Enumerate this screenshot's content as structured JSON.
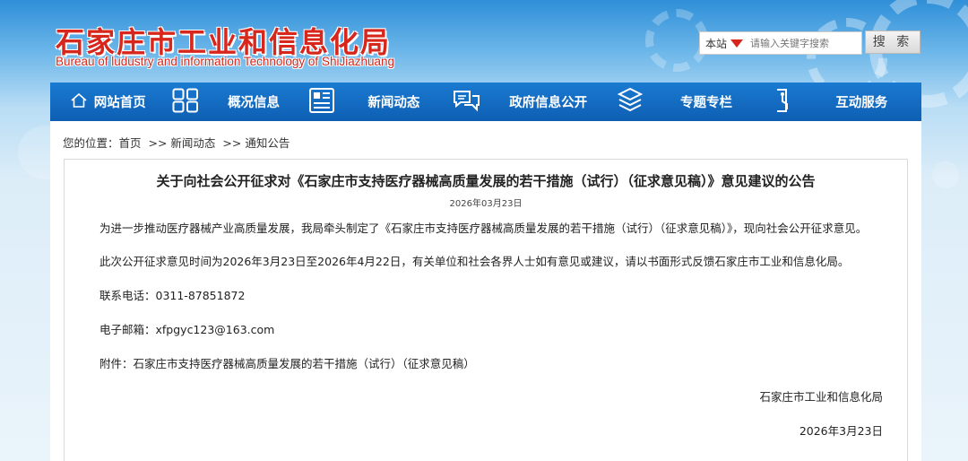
{
  "header": {
    "title": "石家庄市工业和信息化局",
    "subtitle": "Bureau of ludustry and information Technology of ShiJiazhuang"
  },
  "search": {
    "scope": "本站",
    "placeholder": "请输入关键字搜索",
    "button": "搜 索"
  },
  "nav": {
    "items": [
      {
        "label": "网站首页",
        "icon": "home-icon"
      },
      {
        "label": "概况信息",
        "icon": "grid-icon"
      },
      {
        "label": "新闻动态",
        "icon": "newspaper-icon"
      },
      {
        "label": "政府信息公开",
        "icon": "chat-icon"
      },
      {
        "label": "专题专栏",
        "icon": "layers-icon"
      },
      {
        "label": "互动服务",
        "icon": "interact-icon"
      }
    ]
  },
  "breadcrumb": {
    "prefix": "您的位置：",
    "items": [
      "首页",
      ">> 新闻动态",
      ">> 通知公告"
    ]
  },
  "article": {
    "title": "关于向社会公开征求对《石家庄市支持医疗器械高质量发展的若干措施（试行）（征求意见稿）》意见建议的公告",
    "date": "2026年03月23日",
    "paragraphs": [
      "为进一步推动医疗器械产业高质量发展，我局牵头制定了《石家庄市支持医疗器械高质量发展的若干措施（试行）（征求意见稿）》，现向社会公开征求意见。",
      "此次公开征求意见时间为2026年3月23日至2026年4月22日，有关单位和社会各界人士如有意见或建议，请以书面形式反馈石家庄市工业和信息化局。",
      "联系电话：0311-87851872",
      "电子邮箱：xfpgyc123@163.com",
      "附件：石家庄市支持医疗器械高质量发展的若干措施（试行）（征求意见稿）"
    ],
    "signature": "石家庄市工业和信息化局",
    "sign_date": "2026年3月23日"
  },
  "colors": {
    "brand_red": "#d7261b",
    "nav_blue": "#1a7ad1"
  }
}
